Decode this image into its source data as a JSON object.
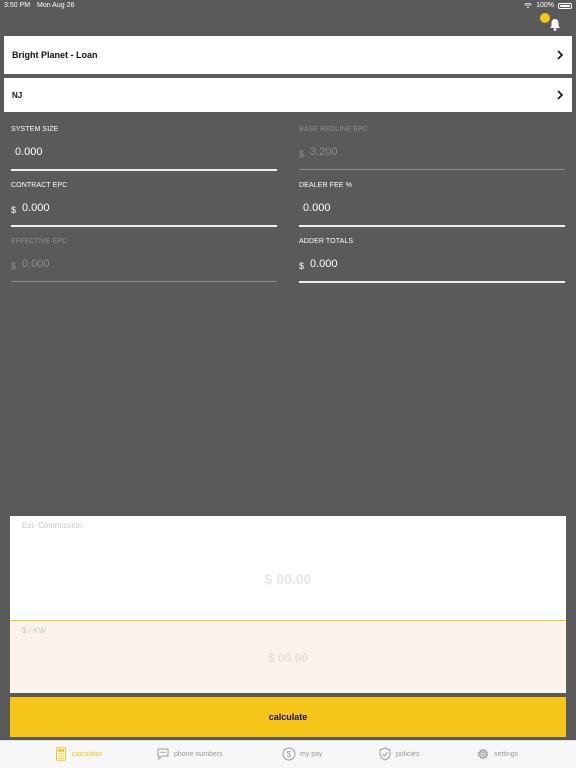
{
  "status_bar": {
    "time": "3:50 PM",
    "date": "Mon Aug 26",
    "battery": "100%"
  },
  "selectors": [
    {
      "label": "Bright Planet - Loan"
    },
    {
      "label": "NJ"
    }
  ],
  "fields": {
    "system_size": {
      "label": "SYSTEM SIZE",
      "currency": "",
      "value": "0.000"
    },
    "base_redline_epc": {
      "label": "BASE REDLINE EPC",
      "currency": "$",
      "value": "3.200"
    },
    "contract_epc": {
      "label": "CONTRACT EPC",
      "currency": "$",
      "value": "0.000"
    },
    "dealer_fee": {
      "label": "DEALER FEE %",
      "currency": "",
      "value": "0.000"
    },
    "effective_epc": {
      "label": "EFFECTIVE EPC",
      "currency": "$",
      "value": "0.000"
    },
    "adder_totals": {
      "label": "ADDER TOTALS",
      "currency": "$",
      "value": "0.000"
    }
  },
  "results": {
    "commission": {
      "label": "Est. Commission",
      "value": "$ 00.00"
    },
    "per_kw": {
      "label": "$ / KW",
      "value": "$ 00.00"
    }
  },
  "calculate_label": "calculate",
  "tabs": [
    {
      "label": "calculator",
      "icon": "calculator-icon",
      "active": true
    },
    {
      "label": "phone numbers",
      "icon": "chat-icon",
      "active": false
    },
    {
      "label": "my pay",
      "icon": "dollar-icon",
      "active": false
    },
    {
      "label": "policies",
      "icon": "shield-icon",
      "active": false
    },
    {
      "label": "settings",
      "icon": "gear-icon",
      "active": false
    }
  ],
  "colors": {
    "accent": "#f5c518",
    "background": "#5b5a5b"
  }
}
